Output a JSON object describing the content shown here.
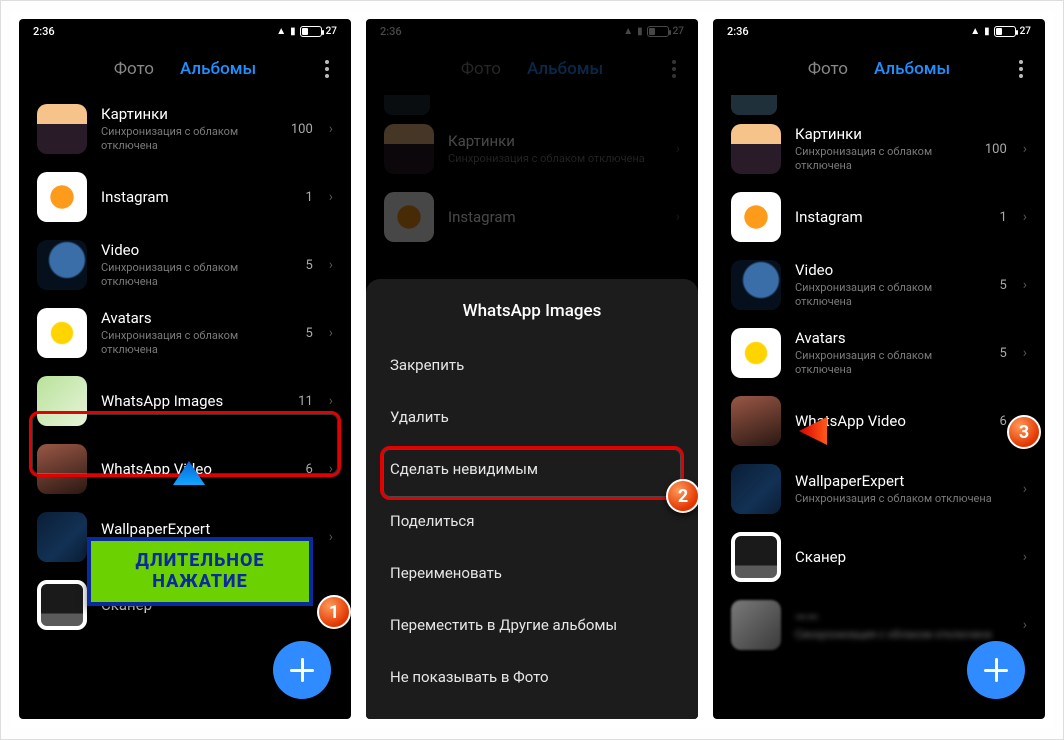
{
  "status": {
    "time": "2:36",
    "battery": "27"
  },
  "tabs": {
    "photos": "Фото",
    "albums": "Альбомы"
  },
  "sync_off": "Синхронизация с облаком отключена",
  "screen1": {
    "albums": [
      {
        "name": "Картинки",
        "count": "100",
        "sub": true,
        "thumb": "sunset"
      },
      {
        "name": "Instagram",
        "count": "1",
        "sub": false,
        "thumb": "orange"
      },
      {
        "name": "Video",
        "count": "5",
        "sub": true,
        "thumb": "earth"
      },
      {
        "name": "Avatars",
        "count": "5",
        "sub": true,
        "thumb": "lemon"
      },
      {
        "name": "WhatsApp Images",
        "count": "11",
        "sub": false,
        "thumb": "waimg"
      },
      {
        "name": "WhatsApp Video",
        "count": "6",
        "sub": false,
        "thumb": "wavid"
      },
      {
        "name": "WallpaperExpert",
        "count": "",
        "sub": true,
        "thumb": "wallx"
      },
      {
        "name": "Сканер",
        "count": "",
        "sub": false,
        "thumb": "scan"
      }
    ]
  },
  "screen2": {
    "dimmed": [
      {
        "name": "Картинки",
        "sub": true,
        "thumb": "sunset"
      },
      {
        "name": "Instagram",
        "sub": false,
        "thumb": "orange"
      }
    ],
    "sheet_title": "WhatsApp Images",
    "actions": [
      "Закрепить",
      "Удалить",
      "Сделать невидимым",
      "Поделиться",
      "Переименовать",
      "Переместить в Другие альбомы",
      "Не показывать в Фото"
    ]
  },
  "screen3": {
    "albums": [
      {
        "name": "Картинки",
        "count": "100",
        "sub": true,
        "thumb": "sunset"
      },
      {
        "name": "Instagram",
        "count": "1",
        "sub": false,
        "thumb": "orange"
      },
      {
        "name": "Video",
        "count": "5",
        "sub": true,
        "thumb": "earth"
      },
      {
        "name": "Avatars",
        "count": "5",
        "sub": true,
        "thumb": "lemon"
      },
      {
        "name": "WhatsApp Video",
        "count": "6",
        "sub": false,
        "thumb": "wavid"
      },
      {
        "name": "WallpaperExpert",
        "count": "",
        "sub": true,
        "thumb": "wallx"
      },
      {
        "name": "Сканер",
        "count": "",
        "sub": false,
        "thumb": "scan"
      },
      {
        "name": "——",
        "count": "",
        "sub": true,
        "thumb": "blur",
        "blur": true
      }
    ]
  },
  "annotations": {
    "long_press": "ДЛИТЕЛЬНОЕ НАЖАТИЕ",
    "badge1": "1",
    "badge2": "2",
    "badge3": "3"
  }
}
